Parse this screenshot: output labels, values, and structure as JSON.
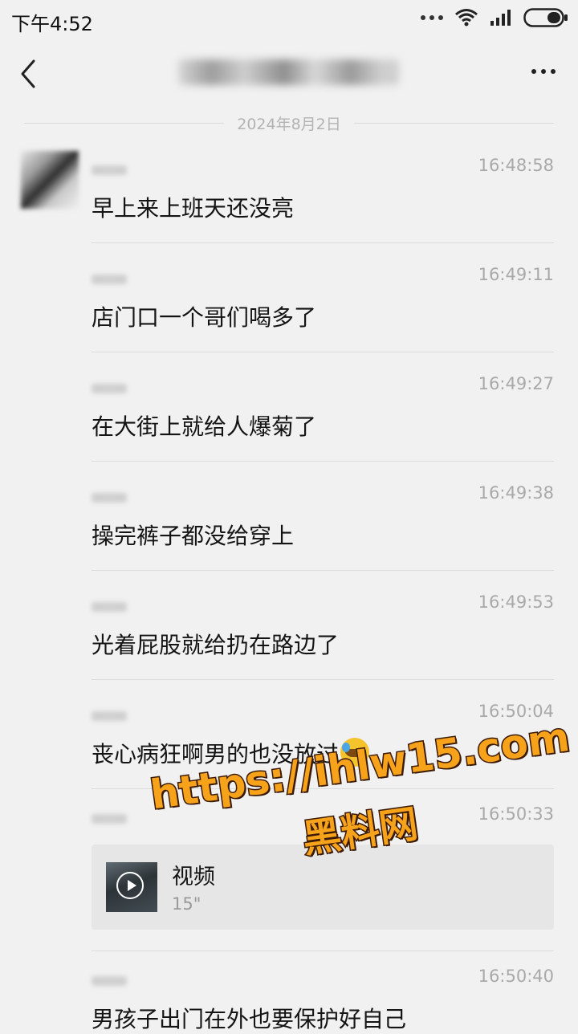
{
  "status_bar": {
    "time": "下午4:52",
    "icons": [
      "more-dots-icon",
      "wifi-icon",
      "signal-icon",
      "battery-icon"
    ]
  },
  "nav": {
    "title": "",
    "back_icon": "chevron-left-icon",
    "more_icon": "more-horizontal-icon"
  },
  "date_divider": "2024年8月2日",
  "messages": [
    {
      "time": "16:48:58",
      "text": "早上来上班天还没亮"
    },
    {
      "time": "16:49:11",
      "text": "店门口一个哥们喝多了"
    },
    {
      "time": "16:49:27",
      "text": "在大街上就给人爆菊了"
    },
    {
      "time": "16:49:38",
      "text": "操完裤子都没给穿上"
    },
    {
      "time": "16:49:53",
      "text": "光着屁股就给扔在路边了"
    },
    {
      "time": "16:50:04",
      "text": "丧心病狂啊男的也没放过",
      "emoji": "crying-laughing-emoji"
    },
    {
      "time": "16:50:33",
      "video": {
        "title": "视频",
        "duration": "15\""
      }
    },
    {
      "time": "16:50:40",
      "text": "男孩子出门在外也要保护好自己"
    }
  ],
  "watermark": {
    "url": "https://ihlw15.com",
    "name": "黑料网",
    "color": "#f7a21b"
  }
}
